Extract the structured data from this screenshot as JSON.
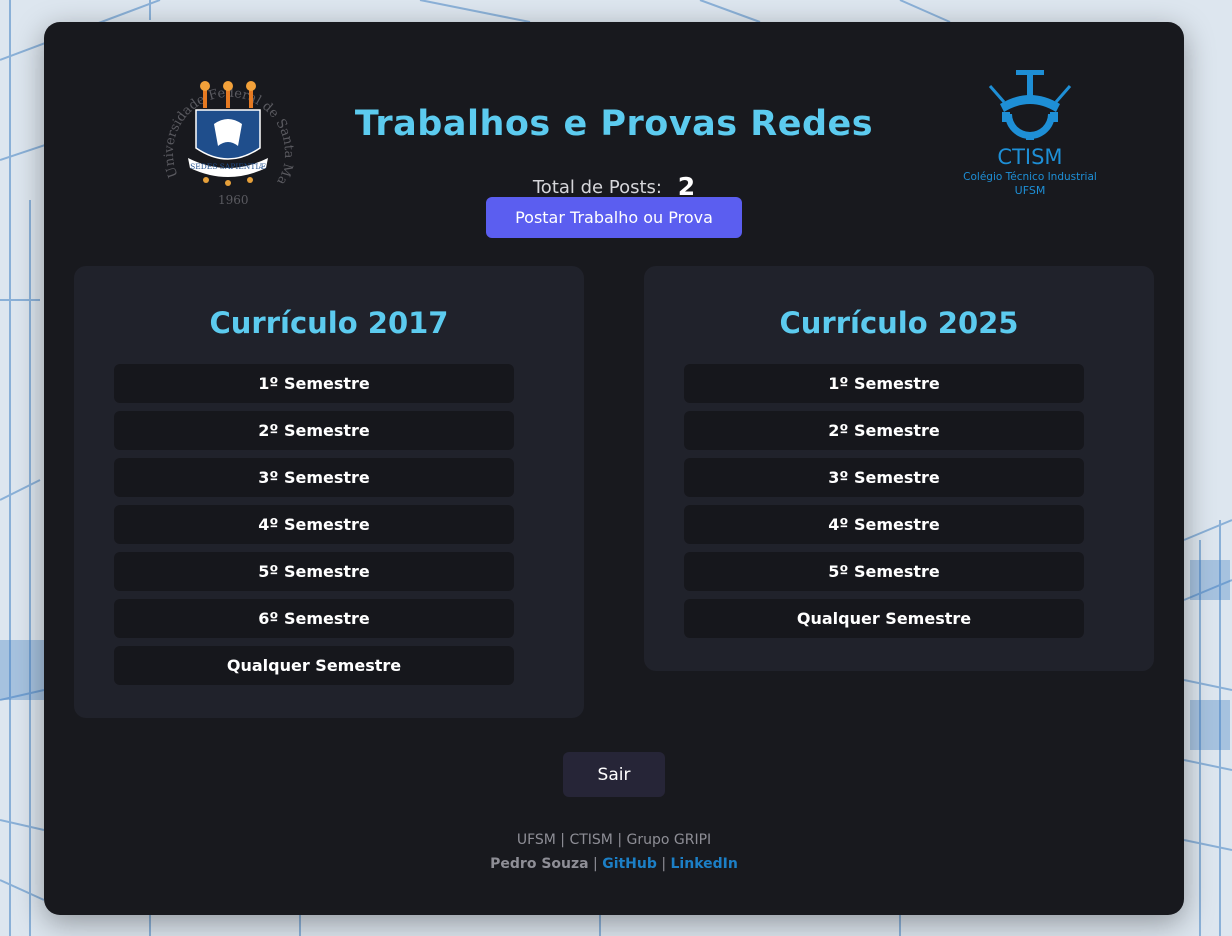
{
  "header": {
    "title": "Trabalhos e Provas Redes",
    "total_label": "Total de Posts:",
    "total_count": "2",
    "post_button": "Postar Trabalho ou Prova"
  },
  "logos": {
    "ufsm": {
      "ring_text": "Universidade Federal de Santa Maria",
      "motto": "SEDES SAPIENTIÆ",
      "year": "1960"
    },
    "ctism": {
      "name": "CTISM",
      "subtitle": "Colégio Técnico Industrial",
      "org": "UFSM"
    }
  },
  "curricula": [
    {
      "title": "Currículo 2017",
      "semesters": [
        "1º Semestre",
        "2º Semestre",
        "3º Semestre",
        "4º Semestre",
        "5º Semestre",
        "6º Semestre",
        "Qualquer Semestre"
      ]
    },
    {
      "title": "Currículo 2025",
      "semesters": [
        "1º Semestre",
        "2º Semestre",
        "3º Semestre",
        "4º Semestre",
        "5º Semestre",
        "Qualquer Semestre"
      ]
    }
  ],
  "exit_button": "Sair",
  "footer": {
    "line1": "UFSM | CTISM | Grupo GRIPI",
    "author": "Pedro Souza",
    "sep": " | ",
    "github": "GitHub",
    "linkedin": "LinkedIn"
  },
  "colors": {
    "accent": "#5ccbef",
    "button": "#5b5ef0",
    "card": "#18191e",
    "panel": "#20222b",
    "link": "#1c7fc6"
  }
}
